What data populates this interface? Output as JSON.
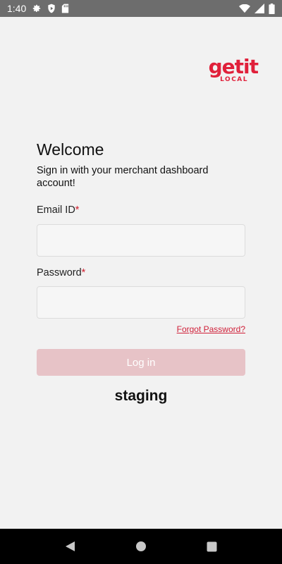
{
  "status_bar": {
    "time": "1:40",
    "icons": [
      "settings-icon",
      "play-protect-icon",
      "sd-card-icon",
      "wifi-icon",
      "signal-icon",
      "battery-icon"
    ]
  },
  "logo": {
    "word": "getit",
    "sub": "LOCAL",
    "color": "#e0203a"
  },
  "login": {
    "title": "Welcome",
    "subtitle": "Sign in with your merchant dashboard account!",
    "email_label": "Email ID",
    "email_value": "",
    "email_placeholder": "",
    "password_label": "Password",
    "password_value": "",
    "password_placeholder": "",
    "required_marker": "*",
    "forgot_label": "Forgot Password?",
    "login_label": "Log in",
    "environment": "staging",
    "accent_color": "#e0203a",
    "button_color": "#e7c3c7"
  },
  "nav_bar": {
    "buttons": [
      "back-icon",
      "home-icon",
      "recents-icon"
    ]
  }
}
